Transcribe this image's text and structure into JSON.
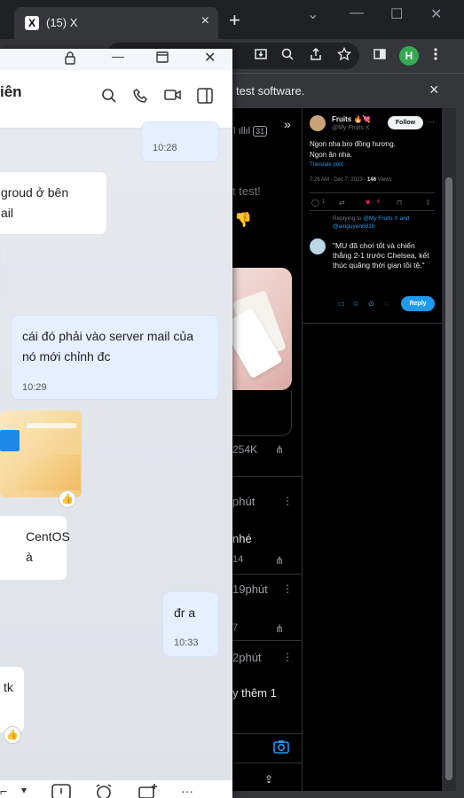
{
  "browser": {
    "tab_title": "(15) X",
    "tab_favicon": "X",
    "new_tab": "+",
    "tab_close": "×",
    "infobar_message": "test software.",
    "infobar_close": "×",
    "profile_initial": "H",
    "win_controls": {
      "dropdown": "⌄",
      "minimize": "—",
      "maximize": "☐",
      "close": "✕"
    }
  },
  "x_left": {
    "status_icons": "»",
    "signal_text": "31",
    "text_fragment_1": "t test!",
    "emoji_fragment": "👎",
    "views_count": "254K",
    "time_1": "phút",
    "text_fragment_2": "nhé",
    "count_1": "14",
    "time_2": "19phút",
    "count_2": "7",
    "time_3": "2phút",
    "text_fragment_3": "y thêm 1"
  },
  "x_tweet": {
    "author": "Fruits 🔥💘",
    "handle": "@My Fruits X",
    "follow_label": "Follow",
    "text_line1": "Ngon nha bro đồng hương.",
    "text_line2": "Ngon ăn nha.",
    "translate": "Translate post",
    "meta_time": "7:26 AM · Dec 7, 2023 · ",
    "meta_views_num": "146",
    "meta_views_label": " Views",
    "reply_count": "1",
    "like_count": "6",
    "replying_to_prefix": "Replying to ",
    "replying_to_users": "@My Fruits X and @ainguyen6818",
    "reply_draft": "\"MU đã chơi tốt và chiến thắng 2-1 trước Chelsea, kết thúc quãng thời gian tồi tệ.\"",
    "reply_button": "Reply"
  },
  "chat": {
    "header_name": "iên",
    "messages": {
      "m1_time": "10:28",
      "m2_text_line1": "groud ở bên",
      "m2_text_line2": "ail",
      "m3_text_line1": "cái đó phải vào server mail của",
      "m3_text_line2": "nó mới chỉnh đc",
      "m3_time": "10:29",
      "m4_text_line1": "CentOS à",
      "m5_text": "đr a",
      "m5_time": "10:33",
      "m6_text": "tk"
    }
  }
}
